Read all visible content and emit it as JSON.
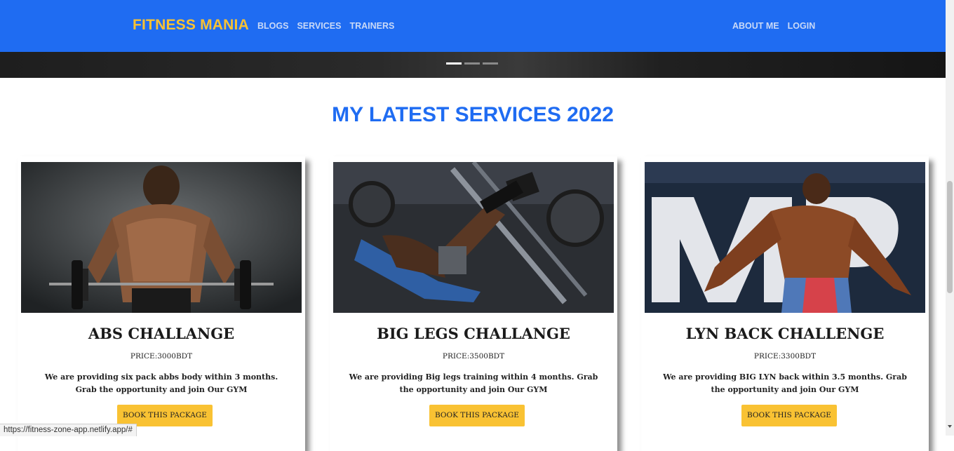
{
  "nav": {
    "brand": "FITNESS MANIA",
    "left_links": [
      "BLOGS",
      "SERVICES",
      "TRAINERS"
    ],
    "right_links": [
      "ABOUT ME",
      "LOGIN"
    ],
    "brand_color": "#f9c233",
    "bar_color": "#1f6cf2"
  },
  "carousel": {
    "slide_count": 3,
    "active_index": 0
  },
  "section": {
    "title": "MY LATEST SERVICES 2022"
  },
  "cards": [
    {
      "title": "ABS CHALLANGE",
      "price": "PRICE:3000BDT",
      "description": "We are providing six pack abbs body within 3 months. Grab the opportunity and join Our GYM",
      "button": "BOOK THIS PACKAGE"
    },
    {
      "title": "BIG LEGS CHALLANGE",
      "price": "PRICE:3500BDT",
      "description": "We are providing Big legs training within 4 months. Grab the opportunity and join Our GYM",
      "button": "BOOK THIS PACKAGE"
    },
    {
      "title": "LYN BACK CHALLENGE",
      "price": "PRICE:3300BDT",
      "description": "We are providing BIG LYN back within 3.5 months. Grab the opportunity and join Our GYM",
      "button": "BOOK THIS PACKAGE"
    }
  ],
  "status_bar": {
    "url": "https://fitness-zone-app.netlify.app/#"
  }
}
